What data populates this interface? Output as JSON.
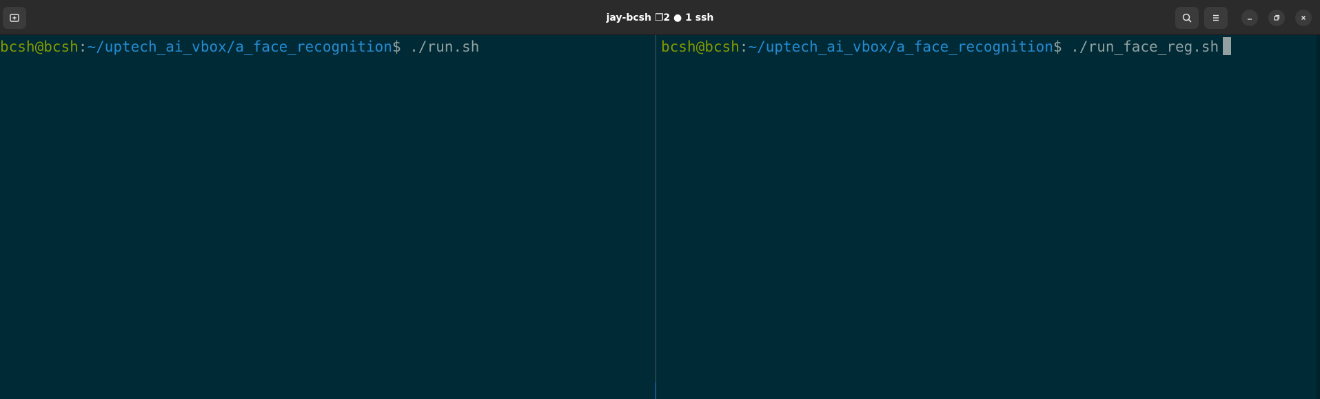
{
  "window": {
    "title_host": "jay-bcsh",
    "title_windows_icon": "❐",
    "title_windows_count": "2",
    "title_pane_icon": "●",
    "title_pane_count": "1",
    "title_process": "ssh"
  },
  "header_icons": {
    "new_tab": "new-tab-icon",
    "search": "search-icon",
    "menu": "hamburger-menu-icon",
    "minimize": "minimize-icon",
    "maximize": "restore-icon",
    "close": "close-icon"
  },
  "panes": {
    "left": {
      "user": "bcsh@bcsh",
      "colon": ":",
      "path": "~/uptech_ai_vbox/a_face_recognition",
      "dollar": "$",
      "command": " ./run.sh"
    },
    "right": {
      "user": "bcsh@bcsh",
      "colon": ":",
      "path": "~/uptech_ai_vbox/a_face_recognition",
      "dollar": "$",
      "command": " ./run_face_reg.sh"
    }
  },
  "colors": {
    "terminal_bg": "#002b36",
    "prompt_user": "#859900",
    "prompt_path": "#268bd2",
    "text": "#93a1a1",
    "focus_accent": "#3584e4"
  }
}
